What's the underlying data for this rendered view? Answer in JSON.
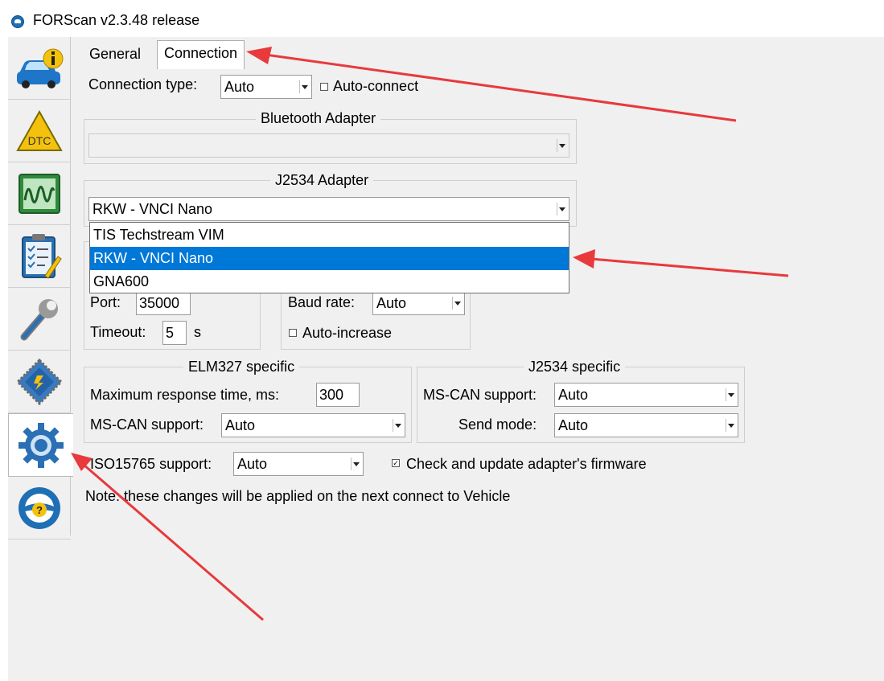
{
  "window": {
    "title": "FORScan v2.3.48 release"
  },
  "sidebar": {
    "items": [
      {
        "name": "vehicle-info"
      },
      {
        "name": "dtc",
        "label": "DTC"
      },
      {
        "name": "oscilloscope"
      },
      {
        "name": "tests"
      },
      {
        "name": "service"
      },
      {
        "name": "configuration"
      },
      {
        "name": "settings"
      },
      {
        "name": "help",
        "label": "?"
      }
    ]
  },
  "tabs": [
    {
      "label": "General"
    },
    {
      "label": "Connection"
    }
  ],
  "connection": {
    "type_label": "Connection type:",
    "type_value": "Auto",
    "auto_connect_label": "Auto-connect",
    "bluetooth_title": "Bluetooth Adapter",
    "j2534_title": "J2534 Adapter",
    "j2534_value": "RKW - VNCI Nano",
    "j2534_options": [
      "TIS Techstream VIM",
      "RKW - VNCI Nano",
      "GNA600"
    ],
    "port_label": "Port:",
    "port_value": "35000",
    "timeout_label": "Timeout:",
    "timeout_value": "5",
    "timeout_unit": "s",
    "baud_label": "Baud rate:",
    "baud_value": "Auto",
    "auto_increase_label": "Auto-increase"
  },
  "elm327": {
    "title": "ELM327 specific",
    "max_resp_label": "Maximum response time, ms:",
    "max_resp_value": "300",
    "mscan_label": "MS-CAN support:",
    "mscan_value": "Auto"
  },
  "j2534": {
    "title": "J2534 specific",
    "mscan_label": "MS-CAN support:",
    "mscan_value": "Auto",
    "send_mode_label": "Send mode:",
    "send_mode_value": "Auto"
  },
  "iso": {
    "label": "ISO15765 support:",
    "value": "Auto",
    "firmware_label": "Check and update adapter's firmware"
  },
  "note": "Note: these changes will be applied on the next connect to Vehicle",
  "colors": {
    "selection": "#0078d7",
    "annotation_arrow": "#e8393c"
  }
}
